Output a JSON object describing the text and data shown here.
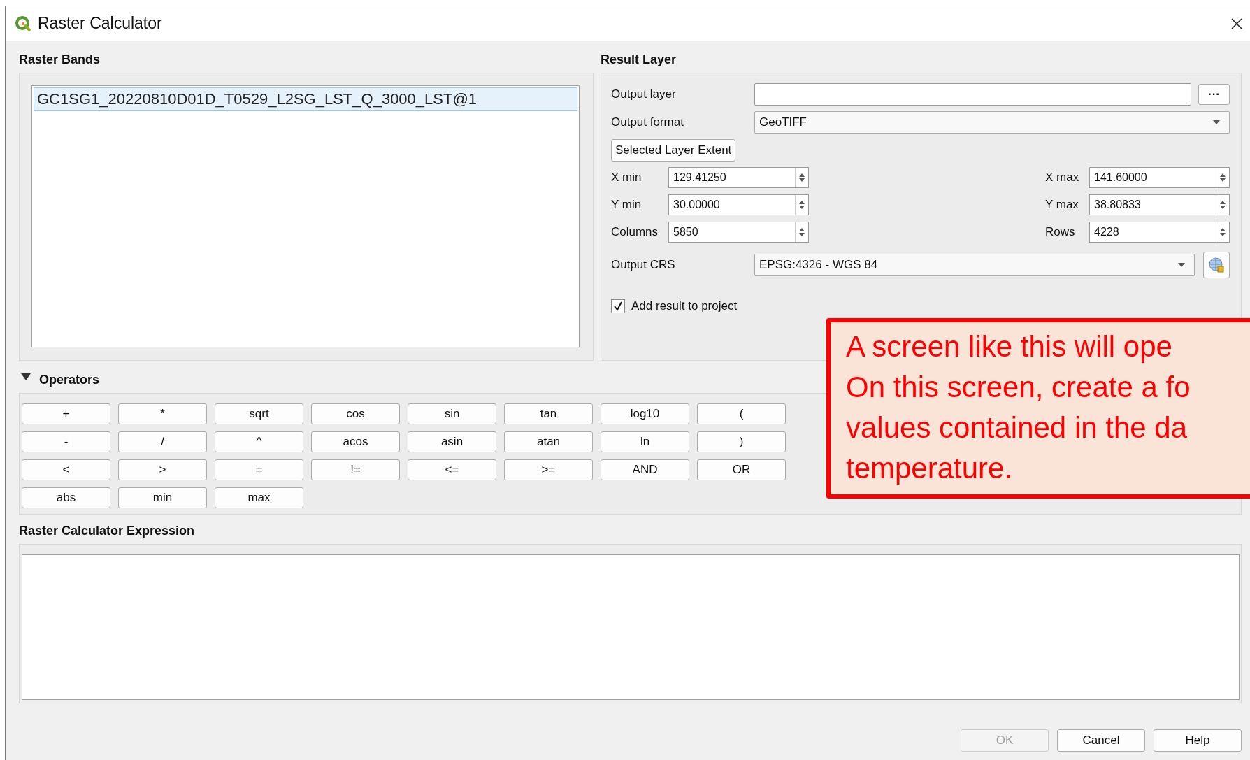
{
  "window": {
    "title": "Raster Calculator"
  },
  "raster_bands": {
    "title": "Raster Bands",
    "items": [
      {
        "label": "GC1SG1_20220810D01D_T0529_L2SG_LST_Q_3000_LST@1",
        "selected": true
      }
    ]
  },
  "result_layer": {
    "title": "Result Layer",
    "output_layer": {
      "label": "Output layer",
      "browse": "···"
    },
    "output_format": {
      "label": "Output format",
      "value": "GeoTIFF"
    },
    "extent_button": "Selected Layer Extent",
    "extent_rows": [
      [
        {
          "label": "X min",
          "value": "129.41250"
        },
        {
          "label": "X max",
          "value": "141.60000"
        }
      ],
      [
        {
          "label": "Y min",
          "value": "30.00000"
        },
        {
          "label": "Y max",
          "value": "38.80833"
        }
      ],
      [
        {
          "label": "Columns",
          "value": "5850"
        },
        {
          "label": "Rows",
          "value": "4228"
        }
      ]
    ],
    "output_crs": {
      "label": "Output CRS",
      "value": "EPSG:4326 - WGS 84"
    },
    "add_to_project": {
      "label": "Add result to project",
      "checked": true
    }
  },
  "operators": {
    "title": "Operators",
    "expanded": true,
    "rows": [
      [
        "+",
        "*",
        "sqrt",
        "cos",
        "sin",
        "tan",
        "log10",
        "("
      ],
      [
        "-",
        "/",
        "^",
        "acos",
        "asin",
        "atan",
        "ln",
        ")"
      ],
      [
        "<",
        ">",
        "=",
        "!=",
        "<=",
        ">=",
        "AND",
        "OR"
      ],
      [
        "abs",
        "min",
        "max"
      ]
    ]
  },
  "expression": {
    "title": "Raster Calculator Expression"
  },
  "buttons": [
    {
      "label": "OK",
      "disabled": true
    },
    {
      "label": "Cancel",
      "disabled": false
    },
    {
      "label": "Help",
      "disabled": false
    }
  ],
  "annotation": {
    "lines": [
      "A screen like this will ope",
      "On this screen, create a fo",
      "values contained in the da",
      "temperature."
    ]
  }
}
